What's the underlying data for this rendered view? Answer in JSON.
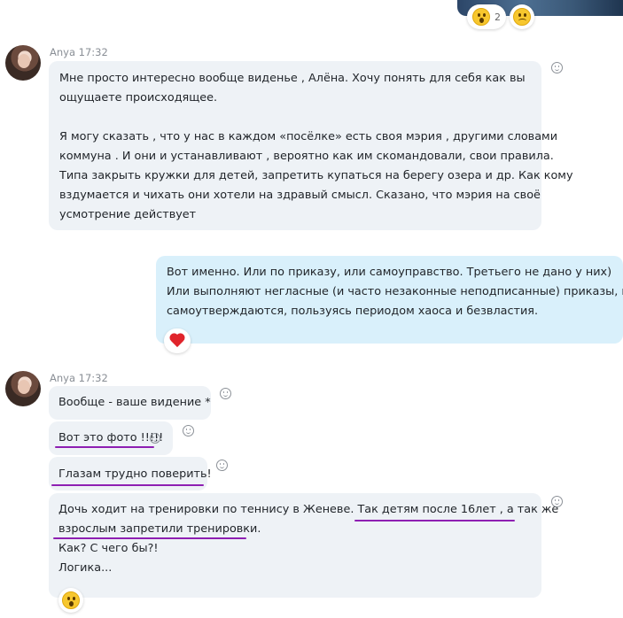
{
  "top_reactions": {
    "count": "2"
  },
  "messages": [
    {
      "sender": "Anya",
      "time": "17:32",
      "text_lines": [
        "Мне просто интересно вообще виденье , Алёна. Хочу понять для себя как вы",
        "ощущаете происходящее.",
        "",
        "Я могу сказать , что у нас в каждом «посёлке» есть своя мэрия , другими словами",
        "коммуна . И они и устанавливают , вероятно как им скомандовали, свои правила.",
        "Типа закрыть кружки для детей, запретить купаться на берегу озера и др. Как кому",
        "вздумается и чихать они хотели на здравый смысл. Сказано, что  мэрия на своё",
        "усмотрение действует"
      ]
    },
    {
      "outgoing": true,
      "text_lines": [
        "Вот именно. Или по приказу, или самоуправство. Третьего не дано у них)",
        "Или выполняют негласные (и часто незаконные неподписанные) приказы, или",
        "самоутверждаются, пользуясь периодом хаоса и безвластия."
      ]
    }
  ],
  "group2": {
    "sender": "Anya",
    "time": "17:32",
    "m1": "Вообще - ваше видение *",
    "m2": "Вот это фото !!!!!",
    "m3": "Глазам трудно поверить!",
    "m4_lines": [
      "Дочь ходит на тренировки по теннису в Женеве. Так детям после 16лет , а так же",
      "взрослым запретили тренировки.",
      "Как? С чего бы?!",
      "Логика..."
    ]
  },
  "colors": {
    "accent_underline": "#8e1fb2",
    "incoming_bg": "#eef2f6",
    "outgoing_bg": "#d9f0fb",
    "heart": "#e0242b"
  },
  "icons": [
    "add-reaction-icon",
    "shocked-emoji-icon",
    "frown-emoji-icon",
    "heart-icon",
    "avatar"
  ]
}
